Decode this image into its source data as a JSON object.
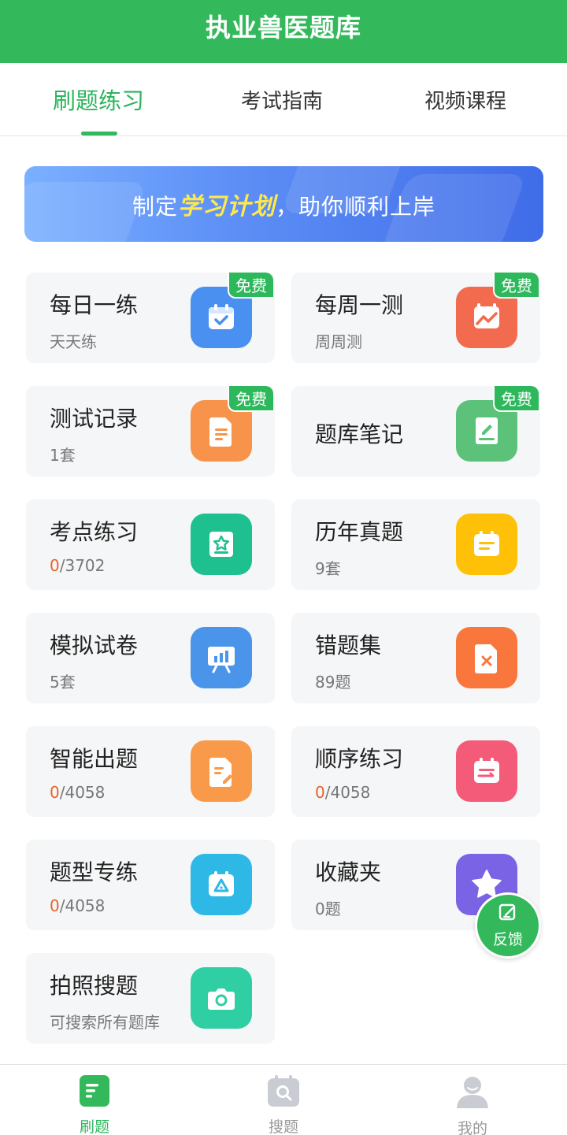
{
  "header": {
    "title": "执业兽医题库"
  },
  "tabs": [
    {
      "label": "刷题练习",
      "active": true
    },
    {
      "label": "考试指南",
      "active": false
    },
    {
      "label": "视频课程",
      "active": false
    }
  ],
  "banner": {
    "text_before": "制定",
    "highlight": "学习计划",
    "text_after": "，助你顺利上岸"
  },
  "free_badge": "免费",
  "cards": [
    {
      "name": "每日一练",
      "sub": "天天练",
      "icon": "calendar-check-icon",
      "color": "#4a90f0",
      "free": true
    },
    {
      "name": "每周一测",
      "sub": "周周测",
      "icon": "chart-trend-icon",
      "color": "#f26b4e",
      "free": true
    },
    {
      "name": "测试记录",
      "sub": "1套",
      "icon": "document-icon",
      "color": "#f7934a",
      "free": true
    },
    {
      "name": "题库笔记",
      "sub": "",
      "icon": "notebook-pen-icon",
      "color": "#5cc27a",
      "free": true
    },
    {
      "name": "考点练习",
      "done": "0",
      "total": "/3702",
      "icon": "star-board-icon",
      "color": "#1fc08f"
    },
    {
      "name": "历年真题",
      "sub": "9套",
      "icon": "calendar-list-icon",
      "color": "#ffc107"
    },
    {
      "name": "模拟试卷",
      "sub": "5套",
      "icon": "presentation-chart-icon",
      "color": "#4a94ea"
    },
    {
      "name": "错题集",
      "sub": "89题",
      "icon": "wrong-file-icon",
      "color": "#f9773d"
    },
    {
      "name": "智能出题",
      "done": "0",
      "total": "/4058",
      "icon": "edit-document-icon",
      "color": "#f99a4a"
    },
    {
      "name": "顺序练习",
      "done": "0",
      "total": "/4058",
      "icon": "calendar-order-icon",
      "color": "#f45b78"
    },
    {
      "name": "题型专练",
      "done": "0",
      "total": "/4058",
      "icon": "triangle-calendar-icon",
      "color": "#2db8e6"
    },
    {
      "name": "收藏夹",
      "sub": "0题",
      "icon": "star-icon",
      "color": "#7b63e6"
    },
    {
      "name": "拍照搜题",
      "sub": "可搜索所有题库",
      "icon": "camera-icon",
      "color": "#2fcfa3"
    }
  ],
  "feedback": {
    "label": "反馈"
  },
  "bottom_nav": [
    {
      "label": "刷题",
      "icon": "document-list-icon",
      "active": true
    },
    {
      "label": "搜题",
      "icon": "search-calendar-icon",
      "active": false
    },
    {
      "label": "我的",
      "icon": "user-icon",
      "active": false
    }
  ],
  "colors": {
    "brand": "#33b95c",
    "progress_done": "#e8622a"
  }
}
